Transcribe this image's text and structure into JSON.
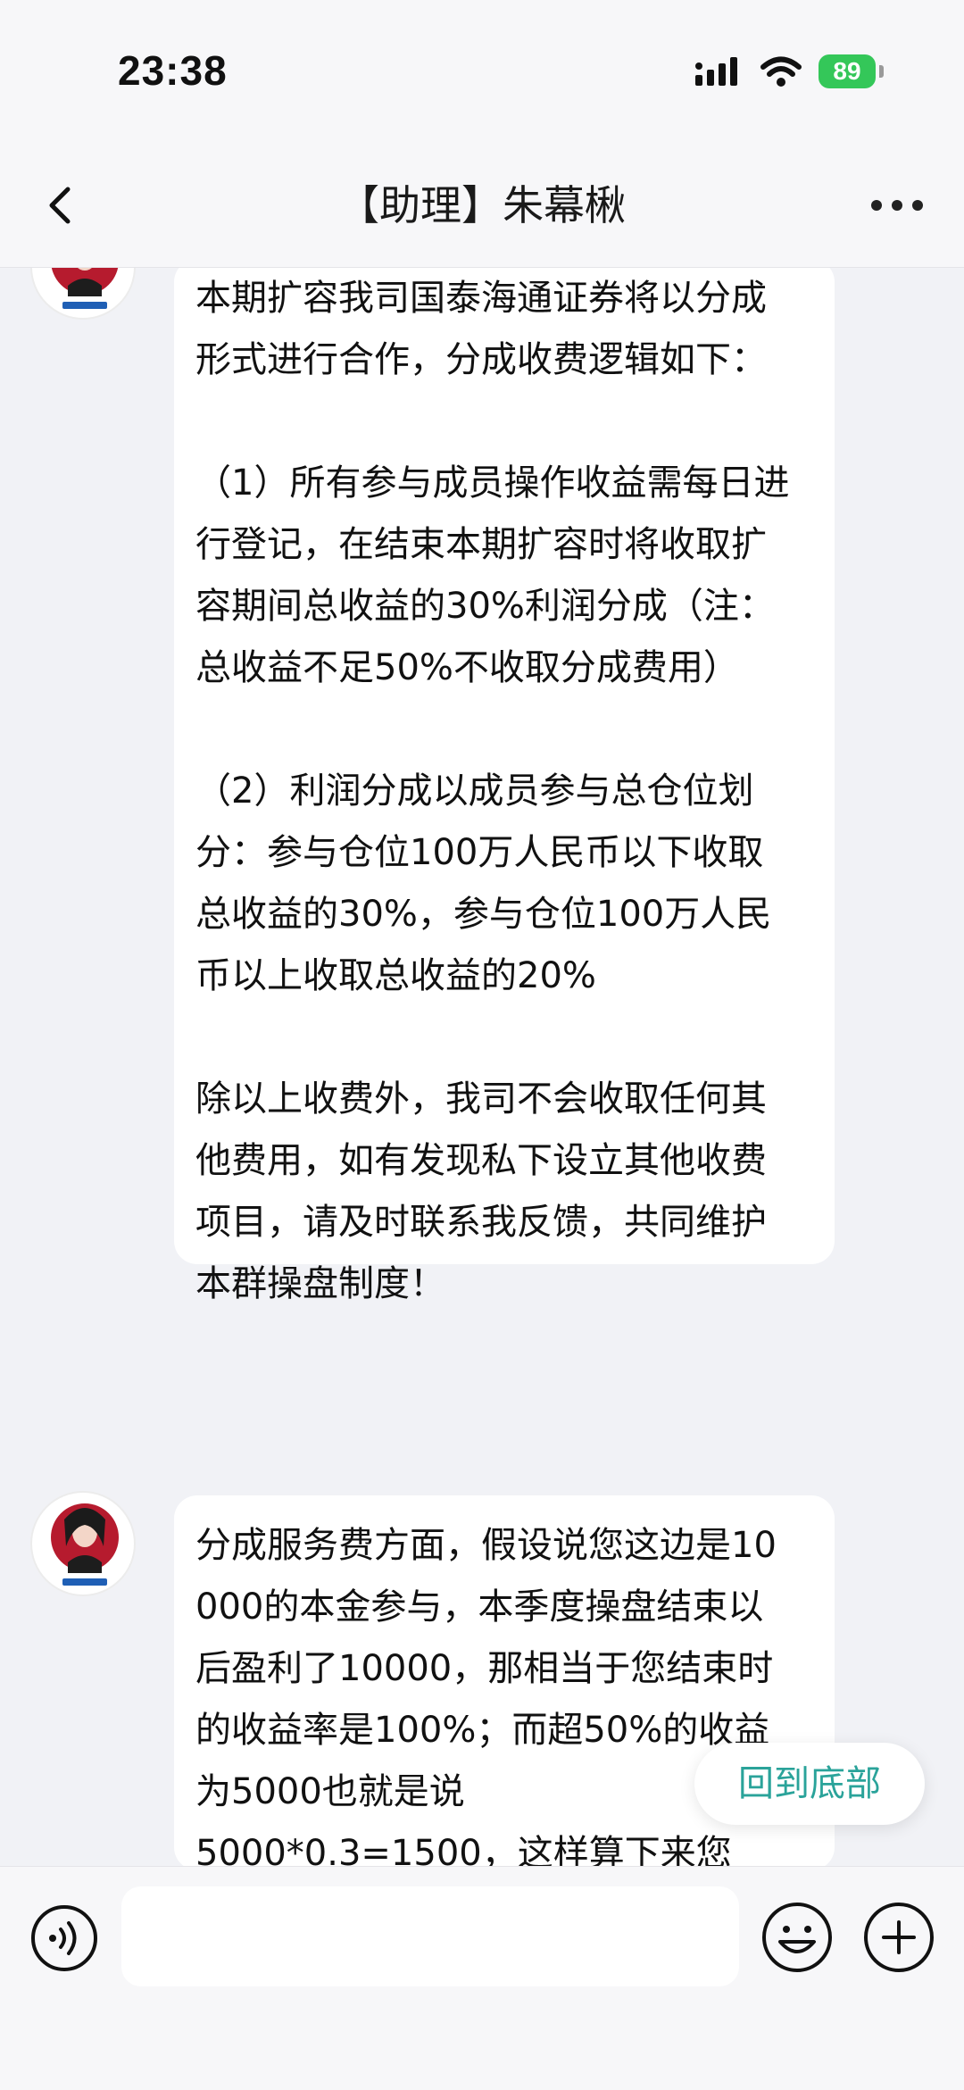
{
  "status_bar": {
    "time": "23:38",
    "battery": "89",
    "icons": [
      "signal-icon",
      "wifi-icon",
      "battery-icon"
    ]
  },
  "nav": {
    "title": "【助理】朱幕楸",
    "icons": [
      "back-icon",
      "more-icon"
    ]
  },
  "messages": [
    {
      "sender_avatar": "avatar-assistant",
      "text": "本期扩容我司国泰海通证券将以分成形式进行合作，分成收费逻辑如下：\n\n（1）所有参与成员操作收益需每日进行登记，在结束本期扩容时将收取扩容期间总收益的30%利润分成（注：总收益不足50%不收取分成费用）\n\n（2）利润分成以成员参与总仓位划分：参与仓位100万人民币以下收取总收益的30%，参与仓位100万人民币以上收取总收益的20%\n\n除以上收费外，我司不会收取任何其他费用，如有发现私下设立其他收费项目，请及时联系我反馈，共同维护本群操盘制度！"
    },
    {
      "sender_avatar": "avatar-assistant",
      "text": "分成服务费方面，假设说您这边是10000的本金参与，本季度操盘结束以后盈利了10000，那相当于您结束时的收益率是100%；而超50%的收益为5000也就是说\n5000*0.3=1500，这样算下来您"
    }
  ],
  "scroll_to_bottom": "回到底部",
  "input": {
    "value": "",
    "icons": [
      "voice-icon",
      "emoji-icon",
      "plus-icon"
    ]
  },
  "colors": {
    "background": "#f1f2f6",
    "bubble": "#ffffff",
    "accent": "#2aa39a",
    "battery": "#34c759"
  }
}
